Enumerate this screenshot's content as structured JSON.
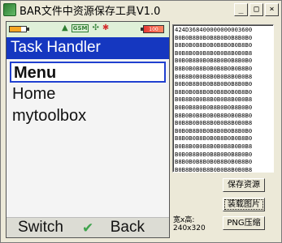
{
  "window": {
    "title": "BAR文件中资源保存工具V1.0",
    "buttons": {
      "minimize": "_",
      "maximize": "□",
      "close": "×"
    }
  },
  "phone": {
    "statusbar": {
      "gsm": "GSM",
      "battery_right_text": "100"
    },
    "header_title": "Task Handler",
    "menu_items": [
      "Menu",
      "Home",
      "mytoolbox"
    ],
    "selected_index": 0,
    "softkeys": {
      "left": "Switch",
      "center_icon": "checkmark-icon",
      "right": "Back"
    }
  },
  "hex_dump": [
    "424D368400000000003600",
    "B0B0B8B0B0B8B0B0B8B0B0",
    "B8B0B0B8B0B0B8B0B0B8B0",
    "B0B8B0B0B8B0B0B8B0B0B8",
    "B0B0B8B0B0B8B0B0B8B0B0",
    "B8B0B0B8B0B0B8B0B0B8B0",
    "B0B8B0B0B8B0B0B8B0B0B8",
    "B0B0B8B0B0B8B0B0B8B0B0",
    "B8B0B0B8B0B0B8B0B0B8B0",
    "B0B8B0B0B8B0B0B8B0B0B8",
    "B0B0B8B0B0B8B0B0B8B0B0",
    "B8B0B0B8B0B0B8B0B0B8B0",
    "B0B8B0B0B8B0B0B8B0B0B8",
    "B0B0B8B0B0B8B0B0B8B0B0",
    "B8B0B0B8B0B0B8B0B0B8B0",
    "B0B8B0B0B8B0B0B8B0B0B8",
    "B0B0B8B0B0B8B0B0B8B0B0",
    "B8B0B0B8B0B0B8B0B0B8B0",
    "B0B8B0B0B8B0B0B8B0B0B8"
  ],
  "buttons": {
    "save": "保存资源",
    "load": "装载图片",
    "png": "PNG压缩"
  },
  "size_info": {
    "label": "宽x高:",
    "value": "240x320"
  },
  "colors": {
    "phone_header": "#1537c0",
    "selection_border": "#2040d0",
    "check": "#3fa34d"
  }
}
